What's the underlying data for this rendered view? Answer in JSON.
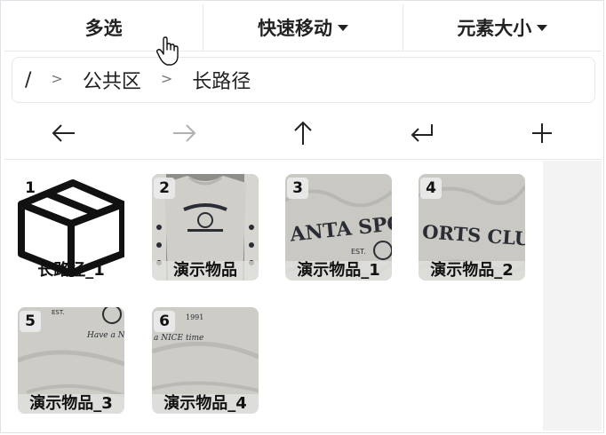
{
  "toolbar": {
    "multi_select": "多选",
    "quick_move": "快速移动",
    "element_size": "元素大小"
  },
  "breadcrumb": {
    "root": "/",
    "separator": ">",
    "level1": "公共区",
    "level2": "长路径"
  },
  "nav": {
    "back_icon": "arrow-left-icon",
    "forward_icon": "arrow-right-icon",
    "up_icon": "arrow-up-icon",
    "enter_icon": "enter-return-icon",
    "add_icon": "plus-icon"
  },
  "items": [
    {
      "num": "1",
      "label": "长路径_1",
      "kind": "folder",
      "icon": "box-icon"
    },
    {
      "num": "2",
      "label": "演示物品",
      "kind": "image"
    },
    {
      "num": "3",
      "label": "演示物品_1",
      "kind": "image"
    },
    {
      "num": "4",
      "label": "演示物品_2",
      "kind": "image"
    },
    {
      "num": "5",
      "label": "演示物品_3",
      "kind": "image"
    },
    {
      "num": "6",
      "label": "演示物品_4",
      "kind": "image"
    }
  ],
  "thumb_texts": {
    "item3_print": "ANTA SPORTS",
    "item3_sub": "EST.",
    "item4_print": "ORTS CLUB",
    "item5_print": "EST.",
    "item5_script": "Have a N",
    "item6_year": "1991",
    "item6_script": "a NICE time"
  },
  "colors": {
    "accent_text": "#222222",
    "disabled_icon": "#b0b0b0",
    "shirt_gray": "#c9c8c3",
    "ink": "#2a2d33",
    "scroll_track": "#f3f3f3"
  }
}
